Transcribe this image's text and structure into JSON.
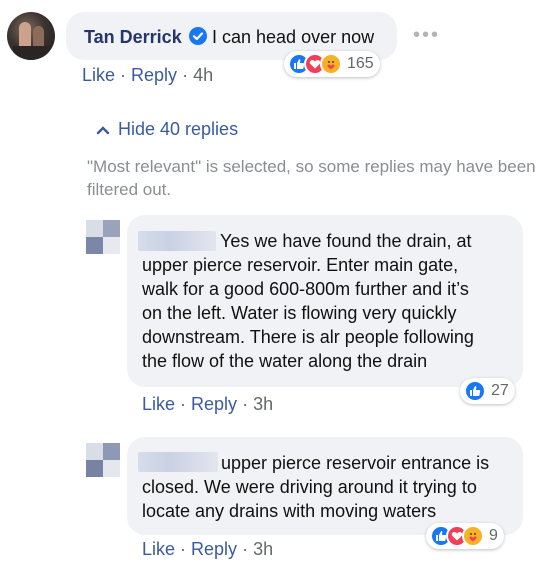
{
  "main_comment": {
    "author": "Tan Derrick",
    "text": "I can head over now",
    "more_label": "•••",
    "reaction_count": "165",
    "actions": {
      "like": "Like",
      "reply": "Reply",
      "time": "4h"
    }
  },
  "replies_toggle": {
    "label": "Hide 40 replies",
    "chevron": "^"
  },
  "filter_notice": "\"Most relevant\" is selected, so some replies may have been filtered out.",
  "replies": [
    {
      "text_lines": [
        "Yes we have found the drain, at",
        "upper pierce reservoir. Enter main gate,",
        "walk for a good 600-800m further and it’s",
        "on the left. Water is flowing very quickly",
        "downstream. There is alr people following",
        "the flow of the water along the drain"
      ],
      "reaction_count": "27",
      "actions": {
        "like": "Like",
        "reply": "Reply",
        "time": "3h"
      }
    },
    {
      "text_lines": [
        "upper pierce reservoir entrance is",
        "closed. We were driving around it trying to",
        "locate any drains with moving waters"
      ],
      "reaction_count": "9",
      "actions": {
        "like": "Like",
        "reply": "Reply",
        "time": "3h"
      }
    }
  ],
  "separator": " · ",
  "colors": {
    "link": "#3a5ba0",
    "like": "#1877f2",
    "love": "#f33e58",
    "care": "#f7b125",
    "bubble": "#f0f2f5"
  },
  "icons": [
    "verified-badge-icon",
    "like-reaction-icon",
    "love-reaction-icon",
    "care-reaction-icon",
    "chevron-up-icon",
    "more-options-icon"
  ]
}
